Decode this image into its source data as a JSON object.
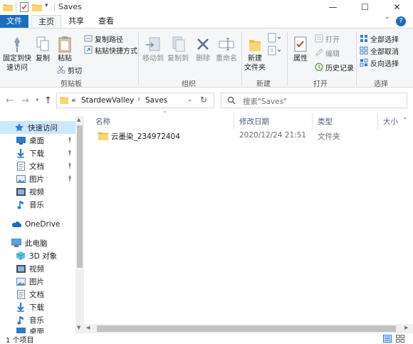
{
  "window": {
    "title": "Saves",
    "controls": {
      "minimize": "—",
      "maximize": "☐",
      "close": "✕"
    }
  },
  "ribbon_tabs": {
    "file": "文件",
    "home": "主页",
    "share": "共享",
    "view": "查看"
  },
  "ribbon": {
    "pin_quick_access_l1": "固定到快",
    "pin_quick_access_l2": "速访问",
    "copy": "复制",
    "paste": "粘贴",
    "copy_path": "复制路径",
    "paste_shortcut": "粘贴快捷方式",
    "cut": "剪切",
    "clipboard_group": "剪贴板",
    "move_to": "移动到",
    "copy_to": "复制到",
    "delete": "删除",
    "rename": "重命名",
    "organize_group": "组织",
    "new_folder_l1": "新建",
    "new_folder_l2": "文件夹",
    "new_group": "新建",
    "properties": "属性",
    "open": "打开",
    "edit": "编辑",
    "history": "历史记录",
    "open_group": "打开",
    "select_all": "全部选择",
    "select_none": "全部取消",
    "invert_selection": "反向选择",
    "select_group": "选择"
  },
  "address": {
    "prefix": "«",
    "segments": [
      "StardewValley",
      "Saves"
    ],
    "search_placeholder": "搜索\"Saves\""
  },
  "nav_pane": {
    "quick_access": "快速访问",
    "quick_items": [
      "桌面",
      "下载",
      "文档",
      "图片",
      "视频",
      "音乐"
    ],
    "onedrive": "OneDrive",
    "this_pc": "此电脑",
    "pc_items": [
      "3D 对象",
      "视频",
      "图片",
      "文档",
      "下载",
      "音乐",
      "桌面"
    ]
  },
  "columns": {
    "name": "名称",
    "date": "修改日期",
    "type": "类型",
    "size": "大小"
  },
  "files": [
    {
      "name": "云墨染_234972404",
      "date": "2020/12/24 21:51",
      "type": "文件夹"
    }
  ],
  "status": {
    "count": "1 个项目"
  },
  "colors": {
    "accent": "#1a6ec2",
    "folder": "#f3c13a",
    "selection": "#cce8ff"
  }
}
